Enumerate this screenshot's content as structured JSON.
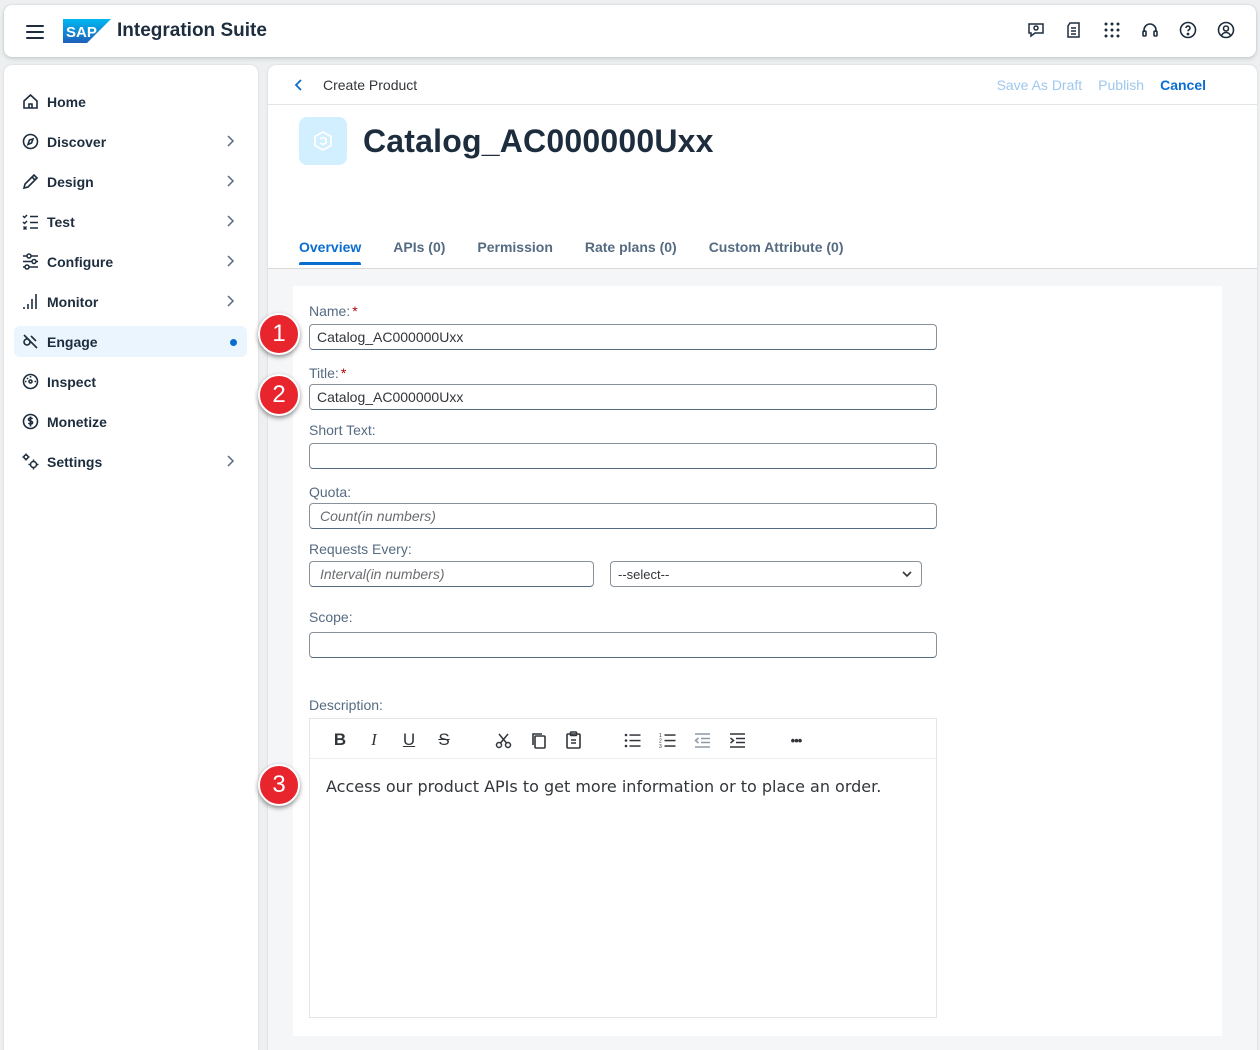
{
  "shell": {
    "logo": "SAP",
    "product_name": "Integration Suite",
    "actions": [
      "chat-icon",
      "notes-icon",
      "grid-icon",
      "headset-icon",
      "help-icon",
      "user-icon"
    ]
  },
  "sidebar": {
    "items": [
      {
        "label": "Home",
        "icon": "home-icon"
      },
      {
        "label": "Discover",
        "icon": "compass-icon"
      },
      {
        "label": "Design",
        "icon": "pencil-icon"
      },
      {
        "label": "Test",
        "icon": "checklist-icon"
      },
      {
        "label": "Configure",
        "icon": "sliders-icon"
      },
      {
        "label": "Monitor",
        "icon": "bar-chart-icon"
      },
      {
        "label": "Engage",
        "icon": "engage-icon",
        "selected": true
      },
      {
        "label": "Inspect",
        "icon": "inspect-icon"
      },
      {
        "label": "Monetize",
        "icon": "dollar-icon"
      },
      {
        "label": "Settings",
        "icon": "gears-icon"
      }
    ]
  },
  "page": {
    "breadcrumb_title": "Create Product",
    "actions": {
      "save_draft": "Save As Draft",
      "publish": "Publish",
      "cancel": "Cancel"
    },
    "title": "Catalog_AC000000Uxx",
    "tabs": [
      "Overview",
      "APIs (0)",
      "Permission",
      "Rate plans (0)",
      "Custom Attribute (0)"
    ]
  },
  "form": {
    "name_label": "Name:",
    "name_value": "Catalog_AC000000Uxx",
    "title_label": "Title:",
    "title_value": "Catalog_AC000000Uxx",
    "required_mark": "*",
    "short_text_label": "Short Text:",
    "short_text_value": "",
    "quota_label": "Quota:",
    "quota_placeholder": "Count(in numbers)",
    "requests_label": "Requests Every:",
    "interval_placeholder": "Interval(in numbers)",
    "interval_select": "--select--",
    "scope_label": "Scope:",
    "scope_value": "",
    "description_label": "Description:",
    "description_value": "Access our product APIs to get more information or to place an order."
  },
  "toolbar": {
    "bold": "B",
    "italic": "I",
    "underline": "U",
    "strike": "S",
    "more": "•••"
  },
  "callouts": {
    "one": "1",
    "two": "2",
    "three": "3"
  },
  "colors": {
    "accent": "#0a6ed1",
    "callout": "#e8242c",
    "selected_nav": "#ebf5fe"
  }
}
